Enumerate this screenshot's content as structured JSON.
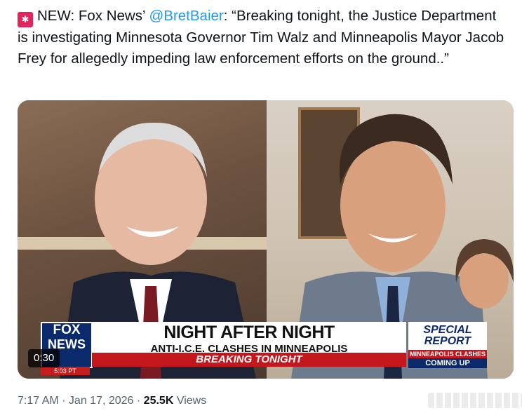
{
  "tweet": {
    "emoji_icon": "police-siren-emoji",
    "prefix": "NEW: Fox News’ ",
    "mention": "@BretBaier",
    "body": ": “Breaking tonight, the Justice Department is investigating Minnesota Governor Tim Walz and Minneapolis Mayor Jacob Frey for allegedly impeding law enforcement efforts on the ground..”"
  },
  "video": {
    "duration": "0:30",
    "chyron": {
      "logo_line1": "FOX",
      "logo_line2": "NEWS",
      "logo_time": "5:03 PT",
      "headline": "NIGHT AFTER NIGHT",
      "subheadline": "ANTI-I.C.E. CLASHES IN MINNEAPOLIS",
      "breaking": "BREAKING TONIGHT",
      "special_line1": "SPECIAL",
      "special_line2": "REPORT",
      "special_line3": "MINNEAPOLIS CLASHES",
      "special_line4": "COMING UP"
    }
  },
  "meta": {
    "time": "7:17 AM",
    "sep1": " · ",
    "date": "Jan 17, 2026",
    "sep2": " · ",
    "views_count": "25.5K",
    "views_label": " Views"
  },
  "colors": {
    "link": "#1d9bf0",
    "text": "#0f1419",
    "muted": "#536471",
    "fox_blue": "#0b2a6b",
    "breaking_red": "#c3171d"
  }
}
